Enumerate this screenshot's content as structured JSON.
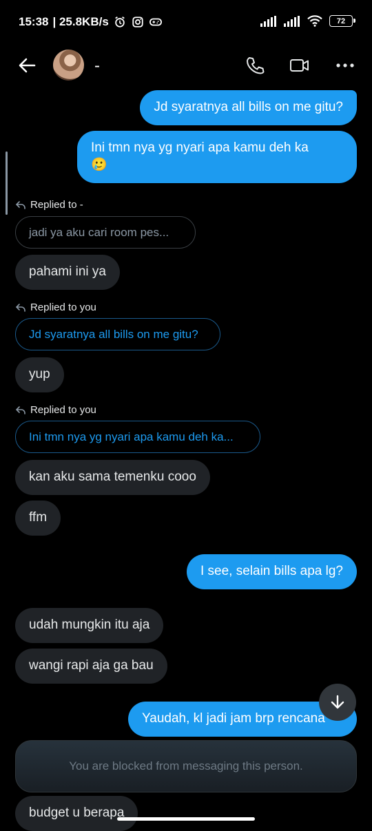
{
  "status": {
    "time": "15:38",
    "speed": "| 25.8KB/s",
    "battery": "72"
  },
  "header": {
    "name": "-"
  },
  "messages": {
    "m1": "Jd syaratnya all bills on me gitu?",
    "m2_line1": "Ini tmn nya yg nyari apa kamu deh ka",
    "m2_emoji": "🥲",
    "reply1_label": "Replied to -",
    "reply1_quote": "jadi ya aku cari room pes...",
    "m3": "pahami ini ya",
    "reply2_label": "Replied to you",
    "reply2_quote": "Jd syaratnya all bills on me gitu?",
    "m4": "yup",
    "reply3_label": "Replied to you",
    "reply3_quote": "Ini tmn nya yg nyari apa kamu deh ka...",
    "m5": "kan aku sama temenku cooo",
    "m6": "ffm",
    "m7": "I see, selain bills apa lg?",
    "m8": "udah mungkin itu aja",
    "m9": "wangi rapi aja ga bau",
    "m10": "Yaudah, kl jadi jam brp rencana",
    "m11": "budget u berapa"
  },
  "blocked_notice": "You are blocked from messaging this person.",
  "colors": {
    "accent": "#1d9bf0",
    "incoming": "#202327",
    "background": "#000000"
  },
  "icons": [
    "alarm-icon",
    "instagram-icon",
    "gamepad-icon",
    "signal-icon",
    "wifi-icon",
    "battery-icon",
    "back-arrow-icon",
    "phone-icon",
    "video-icon",
    "more-icon",
    "reply-icon",
    "arrow-down-icon"
  ]
}
